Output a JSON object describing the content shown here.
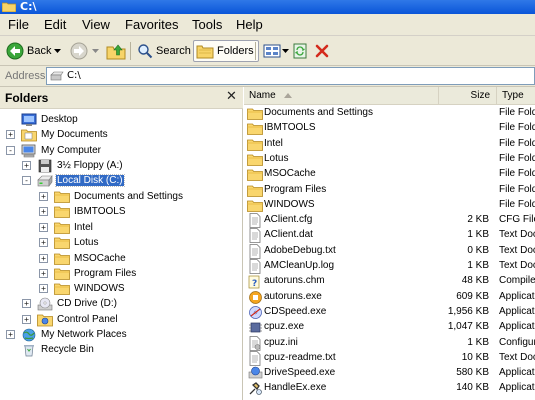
{
  "window": {
    "title": "C:\\"
  },
  "menu": [
    "File",
    "Edit",
    "View",
    "Favorites",
    "Tools",
    "Help"
  ],
  "toolbar": {
    "back_label": "Back",
    "search_label": "Search",
    "folders_label": "Folders"
  },
  "address": {
    "label": "Address",
    "value": "C:\\"
  },
  "folders_pane": {
    "title": "Folders",
    "close_glyph": "✕",
    "tree": [
      {
        "label": "Desktop",
        "icon": "desktop-icon",
        "expander": ""
      },
      {
        "label": "My Documents",
        "icon": "my-documents-icon",
        "expander": "+"
      },
      {
        "label": "My Computer",
        "icon": "my-computer-icon",
        "expander": "−"
      },
      {
        "label": "3½ Floppy (A:)",
        "icon": "floppy-drive-icon",
        "expander": "+"
      },
      {
        "label": "Local Disk (C:)",
        "icon": "hard-drive-icon",
        "expander": "−",
        "selected": true
      },
      {
        "label": "Documents and Settings",
        "icon": "folder-icon",
        "expander": "+"
      },
      {
        "label": "IBMTOOLS",
        "icon": "folder-icon",
        "expander": "+"
      },
      {
        "label": "Intel",
        "icon": "folder-icon",
        "expander": "+"
      },
      {
        "label": "Lotus",
        "icon": "folder-icon",
        "expander": "+"
      },
      {
        "label": "MSOCache",
        "icon": "folder-icon",
        "expander": "+"
      },
      {
        "label": "Program Files",
        "icon": "folder-icon",
        "expander": "+"
      },
      {
        "label": "WINDOWS",
        "icon": "folder-icon",
        "expander": "+"
      },
      {
        "label": "CD Drive (D:)",
        "icon": "cd-drive-icon",
        "expander": "+"
      },
      {
        "label": "Control Panel",
        "icon": "control-panel-icon",
        "expander": "+"
      },
      {
        "label": "My Network Places",
        "icon": "network-places-icon",
        "expander": "+"
      },
      {
        "label": "Recycle Bin",
        "icon": "recycle-bin-icon",
        "expander": ""
      }
    ]
  },
  "file_list": {
    "columns": {
      "name": "Name",
      "size": "Size",
      "type": "Type"
    },
    "rows": [
      {
        "name": "Documents and Settings",
        "size": "",
        "type": "File Folder",
        "icon": "folder-icon"
      },
      {
        "name": "IBMTOOLS",
        "size": "",
        "type": "File Folder",
        "icon": "folder-icon"
      },
      {
        "name": "Intel",
        "size": "",
        "type": "File Folder",
        "icon": "folder-icon"
      },
      {
        "name": "Lotus",
        "size": "",
        "type": "File Folder",
        "icon": "folder-icon"
      },
      {
        "name": "MSOCache",
        "size": "",
        "type": "File Folder",
        "icon": "folder-icon"
      },
      {
        "name": "Program Files",
        "size": "",
        "type": "File Folder",
        "icon": "folder-icon"
      },
      {
        "name": "WINDOWS",
        "size": "",
        "type": "File Folder",
        "icon": "folder-icon"
      },
      {
        "name": "AClient.cfg",
        "size": "2 KB",
        "type": "CFG File",
        "icon": "cfg-file-icon"
      },
      {
        "name": "AClient.dat",
        "size": "1 KB",
        "type": "Text Document",
        "icon": "text-file-icon"
      },
      {
        "name": "AdobeDebug.txt",
        "size": "0 KB",
        "type": "Text Document",
        "icon": "text-file-icon"
      },
      {
        "name": "AMCleanUp.log",
        "size": "1 KB",
        "type": "Text Document",
        "icon": "text-file-icon"
      },
      {
        "name": "autoruns.chm",
        "size": "48 KB",
        "type": "Compiled HTML Help file",
        "icon": "chm-file-icon"
      },
      {
        "name": "autoruns.exe",
        "size": "609 KB",
        "type": "Application",
        "icon": "exe-file-icon"
      },
      {
        "name": "CDSpeed.exe",
        "size": "1,956 KB",
        "type": "Application",
        "icon": "cdspeed-exe-icon"
      },
      {
        "name": "cpuz.exe",
        "size": "1,047 KB",
        "type": "Application",
        "icon": "cpuz-exe-icon"
      },
      {
        "name": "cpuz.ini",
        "size": "1 KB",
        "type": "Configuration Settings",
        "icon": "ini-file-icon"
      },
      {
        "name": "cpuz-readme.txt",
        "size": "10 KB",
        "type": "Text Document",
        "icon": "text-file-icon"
      },
      {
        "name": "DriveSpeed.exe",
        "size": "580 KB",
        "type": "Application",
        "icon": "drivespeed-exe-icon"
      },
      {
        "name": "HandleEx.exe",
        "size": "140 KB",
        "type": "Application",
        "icon": "handleex-exe-icon"
      }
    ]
  }
}
